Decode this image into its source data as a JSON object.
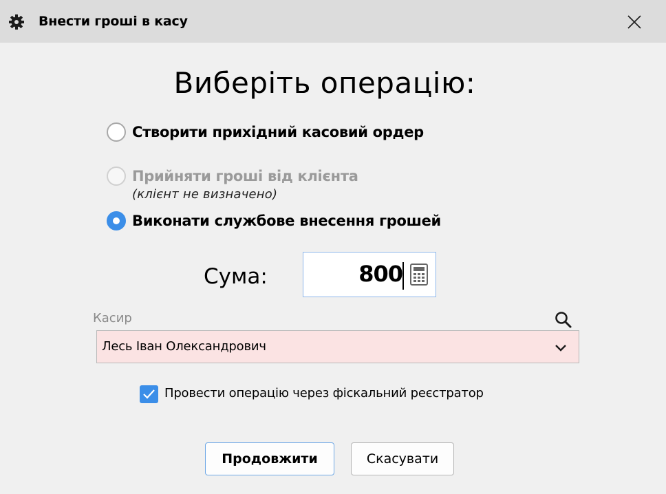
{
  "window": {
    "title": "Внести гроші в касу",
    "icon": "gear-icon",
    "close_icon": "close-icon"
  },
  "heading": "Виберіть операцію:",
  "operations": [
    {
      "label": "Створити прихідний касовий ордер",
      "checked": false,
      "disabled": false
    },
    {
      "label": "Прийняти гроші від клієнта",
      "sub_label": "(клієнт не визначено)",
      "checked": false,
      "disabled": true
    },
    {
      "label": "Виконати службове внесення грошей",
      "checked": true,
      "disabled": false
    }
  ],
  "sum": {
    "label": "Сума:",
    "value": "800",
    "icon": "calculator-icon"
  },
  "cashier": {
    "label": "Касир",
    "value": "Лесь Іван Олександрович",
    "search_icon": "search-icon",
    "dropdown_icon": "chevron-down-icon"
  },
  "fiscal": {
    "label": "Провести операцію через фіскальний реєстратор",
    "checked": true
  },
  "buttons": {
    "continue": "Продовжити",
    "cancel": "Скасувати"
  },
  "colors": {
    "accent": "#3b8ee8",
    "titlebar": "#dcdcdc",
    "background": "#f0f0f0",
    "required_field": "#fbe3e3"
  }
}
